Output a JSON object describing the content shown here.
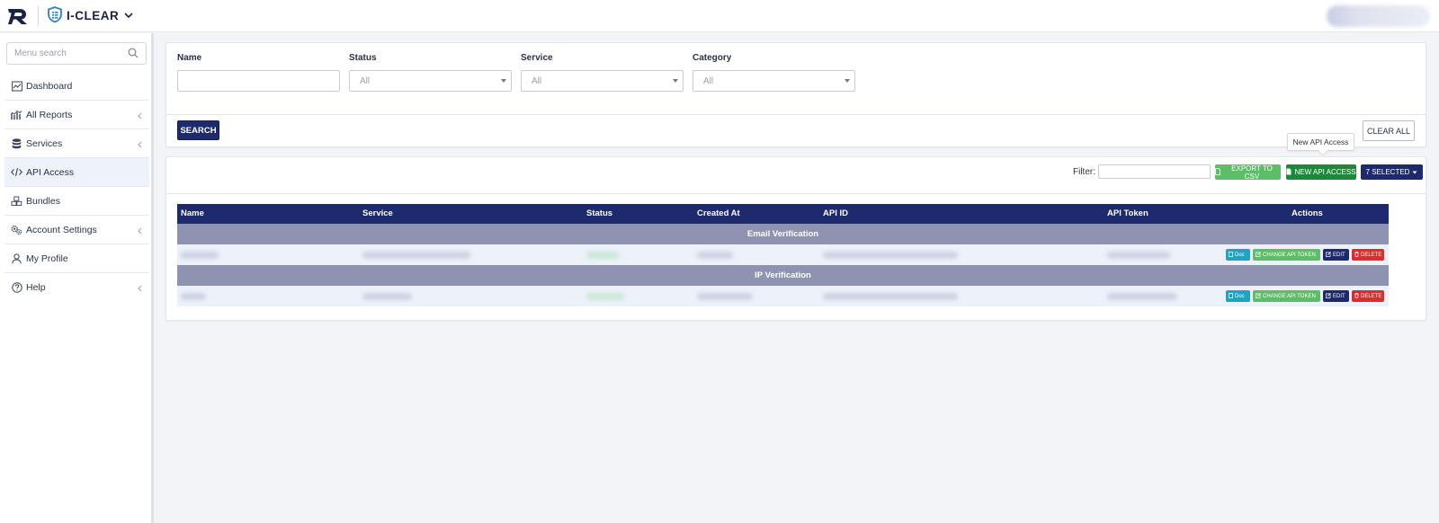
{
  "header": {
    "brand_name": "I-CLEAR"
  },
  "sidebar": {
    "search_placeholder": "Menu search",
    "items": [
      {
        "label": "Dashboard",
        "icon": "dashboard-icon"
      },
      {
        "label": "All Reports",
        "icon": "reports-icon"
      },
      {
        "label": "Services",
        "icon": "database-icon"
      },
      {
        "label": "API Access",
        "icon": "code-icon"
      },
      {
        "label": "Bundles",
        "icon": "bundles-icon"
      },
      {
        "label": "Account Settings",
        "icon": "settings-icon"
      },
      {
        "label": "My Profile",
        "icon": "user-icon"
      },
      {
        "label": "Help",
        "icon": "help-icon"
      }
    ],
    "active_item": "API Access"
  },
  "filters": {
    "name_label": "Name",
    "name_value": "",
    "status_label": "Status",
    "status_value": "All",
    "service_label": "Service",
    "service_value": "All",
    "category_label": "Category",
    "category_value": "All",
    "search_label": "SEARCH",
    "clear_label": "CLEAR ALL"
  },
  "toolbar": {
    "filter_label": "Filter:",
    "export_label": "EXPORT TO CSV",
    "new_label": "NEW API ACCESS",
    "selected_label": "7 SELECTED",
    "tooltip": "New API Access"
  },
  "table": {
    "columns": [
      "Name",
      "Service",
      "Status",
      "Created At",
      "API ID",
      "API Token",
      "Actions"
    ],
    "groups": [
      "Email Verification",
      "IP Verification"
    ],
    "actions": {
      "doc": "Doc",
      "change_token": "CHANGE API TOKEN",
      "edit": "EDIT",
      "delete": "DELETE"
    }
  },
  "colors": {
    "primary": "#1e2a6e",
    "success": "#5cbf67",
    "success_dark": "#1a8a3a",
    "info": "#1ca4c4",
    "danger": "#e02b2b",
    "group_header": "#8d93b0"
  }
}
